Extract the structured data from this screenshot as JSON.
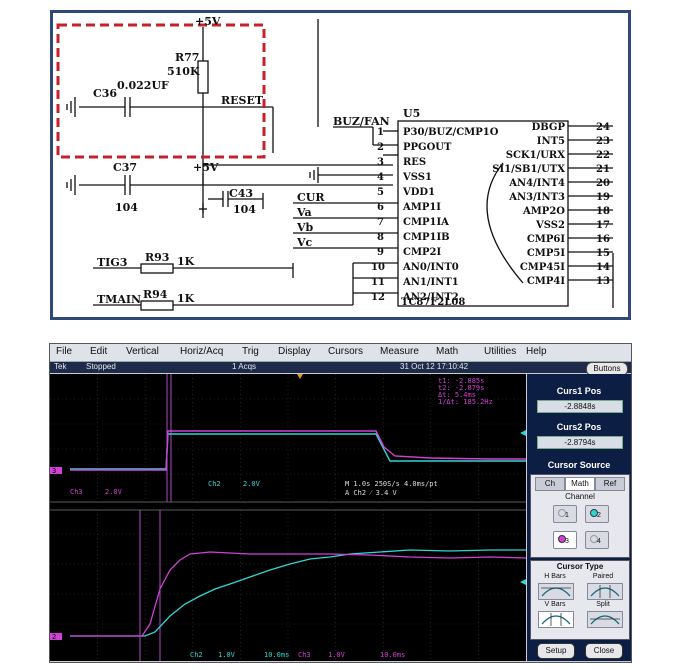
{
  "schematic": {
    "labels": {
      "vcc_top": "+5V",
      "r77": "R77",
      "r77_val": "510K",
      "c36": "C36",
      "c36_val": "0.022UF",
      "reset": "RESET",
      "buz_fan": "BUZ/FAN",
      "u5": "U5",
      "c37": "C37",
      "c37_val": "104",
      "vcc_mid": "+5V",
      "c43": "C43",
      "c43_val": "104",
      "cur": "CUR",
      "va": "Va",
      "vb": "Vb",
      "vc": "Vc",
      "tig3": "TIG3",
      "r93": "R93",
      "r93_val": "1K",
      "tmain": "TMAIN",
      "r94": "R94",
      "r94_val": "1K",
      "chip_name": "TC87F2L08"
    },
    "left_pins": [
      {
        "num": "1",
        "name": "P30/BUZ/CMP1O"
      },
      {
        "num": "2",
        "name": "PPGOUT"
      },
      {
        "num": "3",
        "name": "RES"
      },
      {
        "num": "4",
        "name": "VSS1"
      },
      {
        "num": "5",
        "name": "VDD1"
      },
      {
        "num": "6",
        "name": "AMP1I"
      },
      {
        "num": "7",
        "name": "CMP1IA"
      },
      {
        "num": "8",
        "name": "CMP1IB"
      },
      {
        "num": "9",
        "name": "CMP2I"
      },
      {
        "num": "10",
        "name": "AN0/INT0"
      },
      {
        "num": "11",
        "name": "AN1/INT1"
      },
      {
        "num": "12",
        "name": "AN2/INT2"
      }
    ],
    "right_pins": [
      {
        "num": "24",
        "name": "DBGP"
      },
      {
        "num": "23",
        "name": "INT5"
      },
      {
        "num": "22",
        "name": "SCK1/URX"
      },
      {
        "num": "21",
        "name": "SI1/SB1/UTX"
      },
      {
        "num": "20",
        "name": "AN4/INT4"
      },
      {
        "num": "19",
        "name": "AN3/INT3"
      },
      {
        "num": "18",
        "name": "AMP2O"
      },
      {
        "num": "17",
        "name": "VSS2"
      },
      {
        "num": "16",
        "name": "CMP6I"
      },
      {
        "num": "15",
        "name": "CMP5I"
      },
      {
        "num": "14",
        "name": "CMP45I"
      },
      {
        "num": "13",
        "name": "CMP4I"
      }
    ],
    "colors": {
      "highlight": "#c8202a",
      "frame": "#2f4a7a"
    }
  },
  "scope": {
    "menu": [
      "File",
      "Edit",
      "Vertical",
      "Horiz/Acq",
      "Trig",
      "Display",
      "Cursors",
      "Measure",
      "Math",
      "Utilities",
      "Help"
    ],
    "status": {
      "brand": "Tek",
      "state": "Stopped",
      "acqs": "1 Acqs",
      "datetime": "31 Oct 12 17:10:42"
    },
    "buttons_label": "Buttons",
    "top_readout": [
      "t1: -2.885s",
      "t2: -2.879s",
      "Δt: 5.4ms",
      "1/Δt: 185.2Hz"
    ],
    "top_scale": {
      "ch3": "Ch3",
      "ch3_v": "2.0V",
      "ch2": "Ch2",
      "ch2_v": "2.0V",
      "time": "M 1.0s 250S/s    4.0ms/pt",
      "trig": "A  Ch2  ⁄  3.4    V"
    },
    "bottom_scale": {
      "ch2": "Ch2",
      "ch2_v": "1.0V",
      "div": "10.0ms",
      "ch3": "Ch3",
      "ch3_v": "1.0V",
      "div2": "10.0ms"
    },
    "markers": {
      "ch2": "2",
      "ch3": "3"
    },
    "panel": {
      "curs1_label": "Curs1 Pos",
      "curs1_value": "-2.8848s",
      "curs2_label": "Curs2 Pos",
      "curs2_value": "-2.8794s",
      "source_label": "Cursor Source",
      "tabs": [
        "Ch",
        "Math",
        "Ref"
      ],
      "channel_label": "Channel",
      "channels": [
        "1",
        "2",
        "3",
        "4"
      ],
      "type_label": "Cursor Type",
      "types": [
        "H Bars",
        "Paired",
        "V Bars",
        "Split"
      ],
      "setup": "Setup",
      "close": "Close"
    },
    "colors": {
      "ch2": "#2fd6d6",
      "ch3": "#d240d8",
      "cursor": "#b048c8"
    }
  }
}
